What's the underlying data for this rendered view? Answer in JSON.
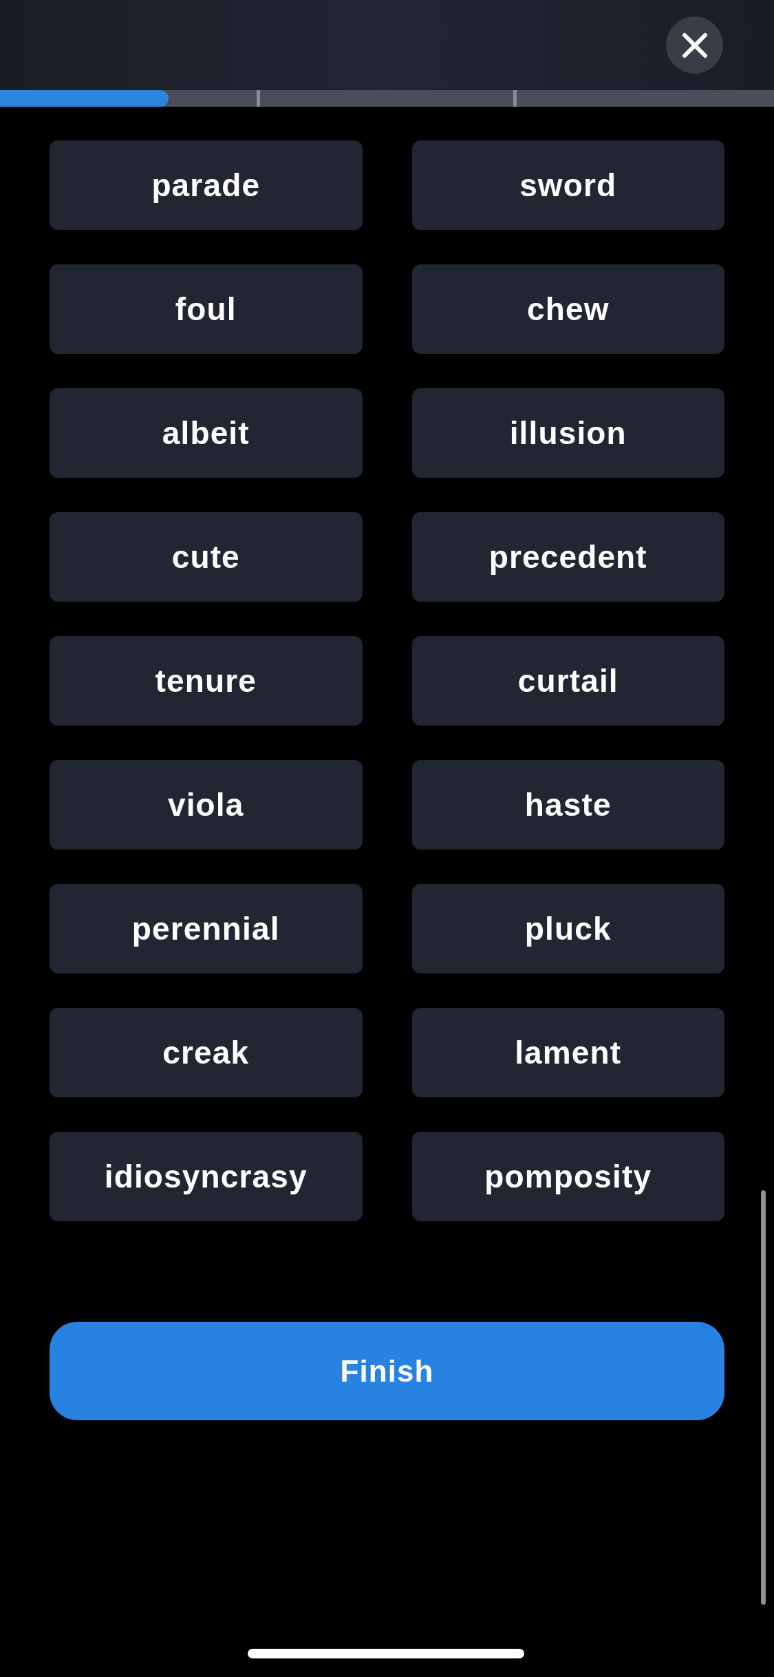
{
  "progress": {
    "level": 0.218
  },
  "words": [
    {
      "label": "parade"
    },
    {
      "label": "sword"
    },
    {
      "label": "foul"
    },
    {
      "label": "chew"
    },
    {
      "label": "albeit"
    },
    {
      "label": "illusion"
    },
    {
      "label": "cute"
    },
    {
      "label": "precedent"
    },
    {
      "label": "tenure"
    },
    {
      "label": "curtail"
    },
    {
      "label": "viola"
    },
    {
      "label": "haste"
    },
    {
      "label": "perennial"
    },
    {
      "label": "pluck"
    },
    {
      "label": "creak"
    },
    {
      "label": "lament"
    },
    {
      "label": "idiosyncrasy"
    },
    {
      "label": "pomposity"
    }
  ],
  "finish_button": {
    "label": "Finish"
  }
}
